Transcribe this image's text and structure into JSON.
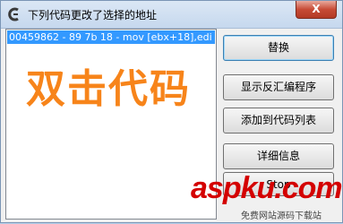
{
  "window": {
    "title": "下列代码更改了选择的地址",
    "close_label": "X"
  },
  "list": {
    "items": [
      "00459862 - 89 7b 18 - mov [ebx+18],edi"
    ]
  },
  "watermark": {
    "text": "双击代码"
  },
  "buttons": {
    "replace": "替换",
    "show_disassembler": "显示反汇编程序",
    "add_to_code_list": "添加到代码列表",
    "more_info": "详细信息",
    "stop": "Stop"
  },
  "site_logo": {
    "text": "aspku.com",
    "subtitle": "免费网站源码下载站"
  },
  "colors": {
    "selection": "#3399ff",
    "watermark": "#f7841a",
    "logo": "#d40000"
  }
}
